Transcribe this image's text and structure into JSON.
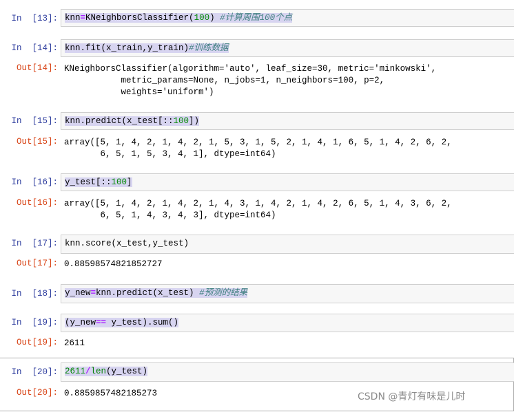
{
  "cells": [
    {
      "in_prompt": "In  [13]:",
      "code": {
        "var": "knn",
        "eq": "=",
        "call": "KNeighborsClassifier(",
        "num": "100",
        "close": ")",
        "sp": " ",
        "comment": "#计算周围100个点"
      }
    },
    {
      "in_prompt": "In  [14]:",
      "code": {
        "text": "knn.fit(x_train,y_train)",
        "comment": "#训练数据"
      },
      "out_prompt": "Out[14]:",
      "output": "KNeighborsClassifier(algorithm='auto', leaf_size=30, metric='minkowski',\n           metric_params=None, n_jobs=1, n_neighbors=100, p=2,\n           weights='uniform')"
    },
    {
      "in_prompt": "In  [15]:",
      "code": {
        "pre": "knn.predict(x_test[::",
        "num": "100",
        "post": "])"
      },
      "out_prompt": "Out[15]:",
      "output": "array([5, 1, 4, 2, 1, 4, 2, 1, 5, 3, 1, 5, 2, 1, 4, 1, 6, 5, 1, 4, 2, 6, 2,\n       6, 5, 1, 5, 3, 4, 1], dtype=int64)"
    },
    {
      "in_prompt": "In  [16]:",
      "code": {
        "pre": "y_test[::",
        "num": "100",
        "post": "]"
      },
      "out_prompt": "Out[16]:",
      "output": "array([5, 1, 4, 2, 1, 4, 2, 1, 4, 3, 1, 4, 2, 1, 4, 2, 6, 5, 1, 4, 3, 6, 2,\n       6, 5, 1, 4, 3, 4, 3], dtype=int64)"
    },
    {
      "in_prompt": "In  [17]:",
      "code": {
        "text": "knn.score(x_test,y_test)"
      },
      "out_prompt": "Out[17]:",
      "output": "0.88598574821852727"
    },
    {
      "in_prompt": "In  [18]:",
      "code": {
        "var": "y_new",
        "eq": "=",
        "text": "knn.predict(x_test) ",
        "comment": "#预测的结果"
      }
    },
    {
      "in_prompt": "In  [19]:",
      "code": {
        "pre": "(y_new",
        "op": "==",
        "post": " y_test).sum()"
      },
      "out_prompt": "Out[19]:",
      "output": "2611"
    },
    {
      "in_prompt": "In  [20]:",
      "code": {
        "num": "2611",
        "op": "/",
        "bi": "len",
        "post": "(y_test)"
      },
      "out_prompt": "Out[20]:",
      "output": "0.8859857482185273"
    }
  ],
  "watermark": "CSDN @青灯有味是儿时",
  "colors": {
    "in_prompt": "#303f9f",
    "out_prompt": "#d84315",
    "number": "#008800",
    "operator": "#aa22ff",
    "comment": "#408080",
    "selection": "#d7d4f0"
  }
}
